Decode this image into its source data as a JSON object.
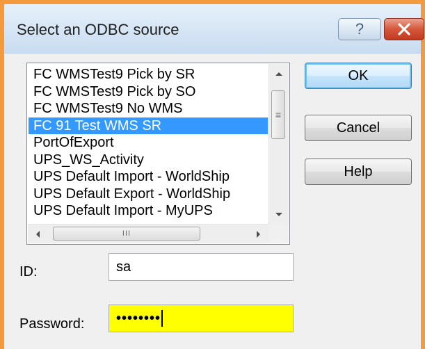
{
  "window": {
    "title": "Select an ODBC source",
    "help_glyph": "?",
    "border_color": "#f39a3e"
  },
  "datasources": {
    "items": [
      "FC WMSTest9 Pick by SR",
      "FC WMSTest9 Pick by SO",
      "FC WMSTest9 No WMS",
      "FC 91 Test WMS SR",
      "PortOfExport",
      "UPS_WS_Activity",
      "UPS Default Import - WorldShip",
      "UPS Default Export - WorldShip",
      "UPS Default Import - MyUPS"
    ],
    "selected_index": 3,
    "selected_color": "#3399ff",
    "hscroll_thumb_grip": "III",
    "vscroll_thumb_grip": "≡"
  },
  "buttons": {
    "ok": "OK",
    "cancel": "Cancel",
    "help": "Help"
  },
  "fields": {
    "id_label": "ID:",
    "id_value": "sa",
    "password_label": "Password:",
    "password_value": "••••••••",
    "password_highlight": "#ffff00"
  }
}
